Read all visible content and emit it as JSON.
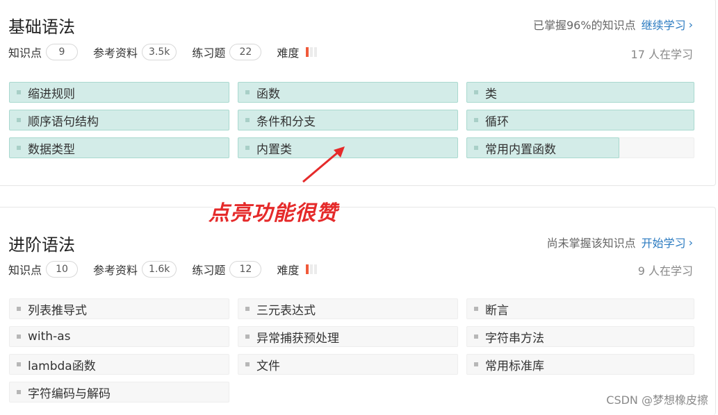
{
  "section1": {
    "title": "基础语法",
    "progress_text": "已掌握96%的知识点",
    "action": "继续学习",
    "stats": {
      "knowledge_label": "知识点",
      "knowledge_count": "9",
      "ref_label": "参考资料",
      "ref_count": "3.5k",
      "exercise_label": "练习题",
      "exercise_count": "22",
      "difficulty_label": "难度"
    },
    "learners": "17 人在学习",
    "tags": [
      {
        "label": "缩进规则",
        "state": "lit"
      },
      {
        "label": "函数",
        "state": "lit"
      },
      {
        "label": "类",
        "state": "lit"
      },
      {
        "label": "顺序语句结构",
        "state": "lit"
      },
      {
        "label": "条件和分支",
        "state": "lit"
      },
      {
        "label": "循环",
        "state": "lit"
      },
      {
        "label": "数据类型",
        "state": "lit"
      },
      {
        "label": "内置类",
        "state": "lit"
      },
      {
        "label": "常用内置函数",
        "state": "partial"
      }
    ]
  },
  "section2": {
    "title": "进阶语法",
    "progress_text": "尚未掌握该知识点",
    "action": "开始学习",
    "stats": {
      "knowledge_label": "知识点",
      "knowledge_count": "10",
      "ref_label": "参考资料",
      "ref_count": "1.6k",
      "exercise_label": "练习题",
      "exercise_count": "12",
      "difficulty_label": "难度"
    },
    "learners": "9 人在学习",
    "tags": [
      {
        "label": "列表推导式",
        "state": "dim"
      },
      {
        "label": "三元表达式",
        "state": "dim"
      },
      {
        "label": "断言",
        "state": "dim"
      },
      {
        "label": "with-as",
        "state": "dim"
      },
      {
        "label": "异常捕获预处理",
        "state": "dim"
      },
      {
        "label": "字符串方法",
        "state": "dim"
      },
      {
        "label": "lambda函数",
        "state": "dim"
      },
      {
        "label": "文件",
        "state": "dim"
      },
      {
        "label": "常用标准库",
        "state": "dim"
      },
      {
        "label": "字符编码与解码",
        "state": "dim"
      }
    ]
  },
  "annotation": "点亮功能很赞",
  "watermark": "CSDN @梦想橡皮擦",
  "colors": {
    "accent": "#2a7ac0",
    "lit_bg": "#d3ece8",
    "annotation": "#e52a2a",
    "difficulty": "#f05a3a"
  }
}
